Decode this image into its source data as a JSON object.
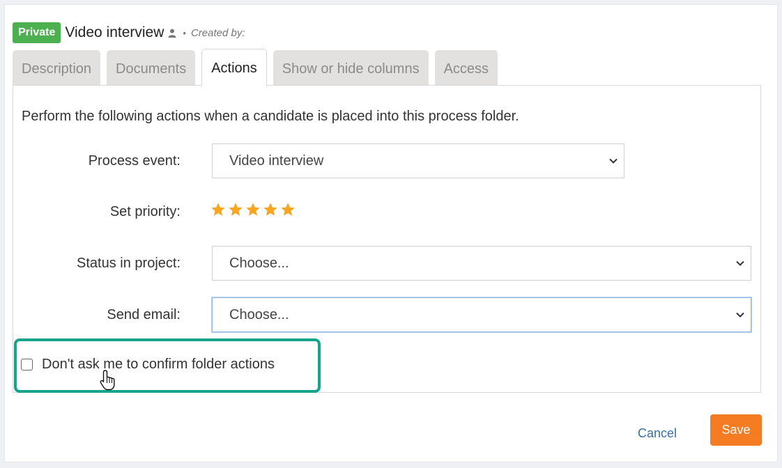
{
  "header": {
    "badge": "Private",
    "title": "Video interview",
    "separator": "•",
    "created_by": "Created by:"
  },
  "tabs": [
    {
      "label": "Description",
      "active": false
    },
    {
      "label": "Documents",
      "active": false
    },
    {
      "label": "Actions",
      "active": true
    },
    {
      "label": "Show or hide columns",
      "active": false
    },
    {
      "label": "Access",
      "active": false
    }
  ],
  "actions": {
    "intro": "Perform the following actions when a candidate is placed into this process folder.",
    "process_event": {
      "label": "Process event:",
      "value": "Video interview"
    },
    "priority": {
      "label": "Set priority:",
      "stars_filled": 5,
      "stars_total": 5
    },
    "status": {
      "label": "Status in project:",
      "value": "Choose..."
    },
    "email": {
      "label": "Send email:",
      "value": "Choose..."
    },
    "confirm_checkbox": {
      "label": "Don't ask me to confirm folder actions",
      "checked": false
    }
  },
  "footer": {
    "cancel": "Cancel",
    "save": "Save"
  },
  "colors": {
    "badge": "#4caf50",
    "star": "#f5a623",
    "save": "#f57c22",
    "highlight": "#16a58a",
    "link": "#3a6ea5"
  },
  "icons": [
    "user-icon",
    "star-icon",
    "chevron-down-icon",
    "hand-cursor-icon"
  ]
}
